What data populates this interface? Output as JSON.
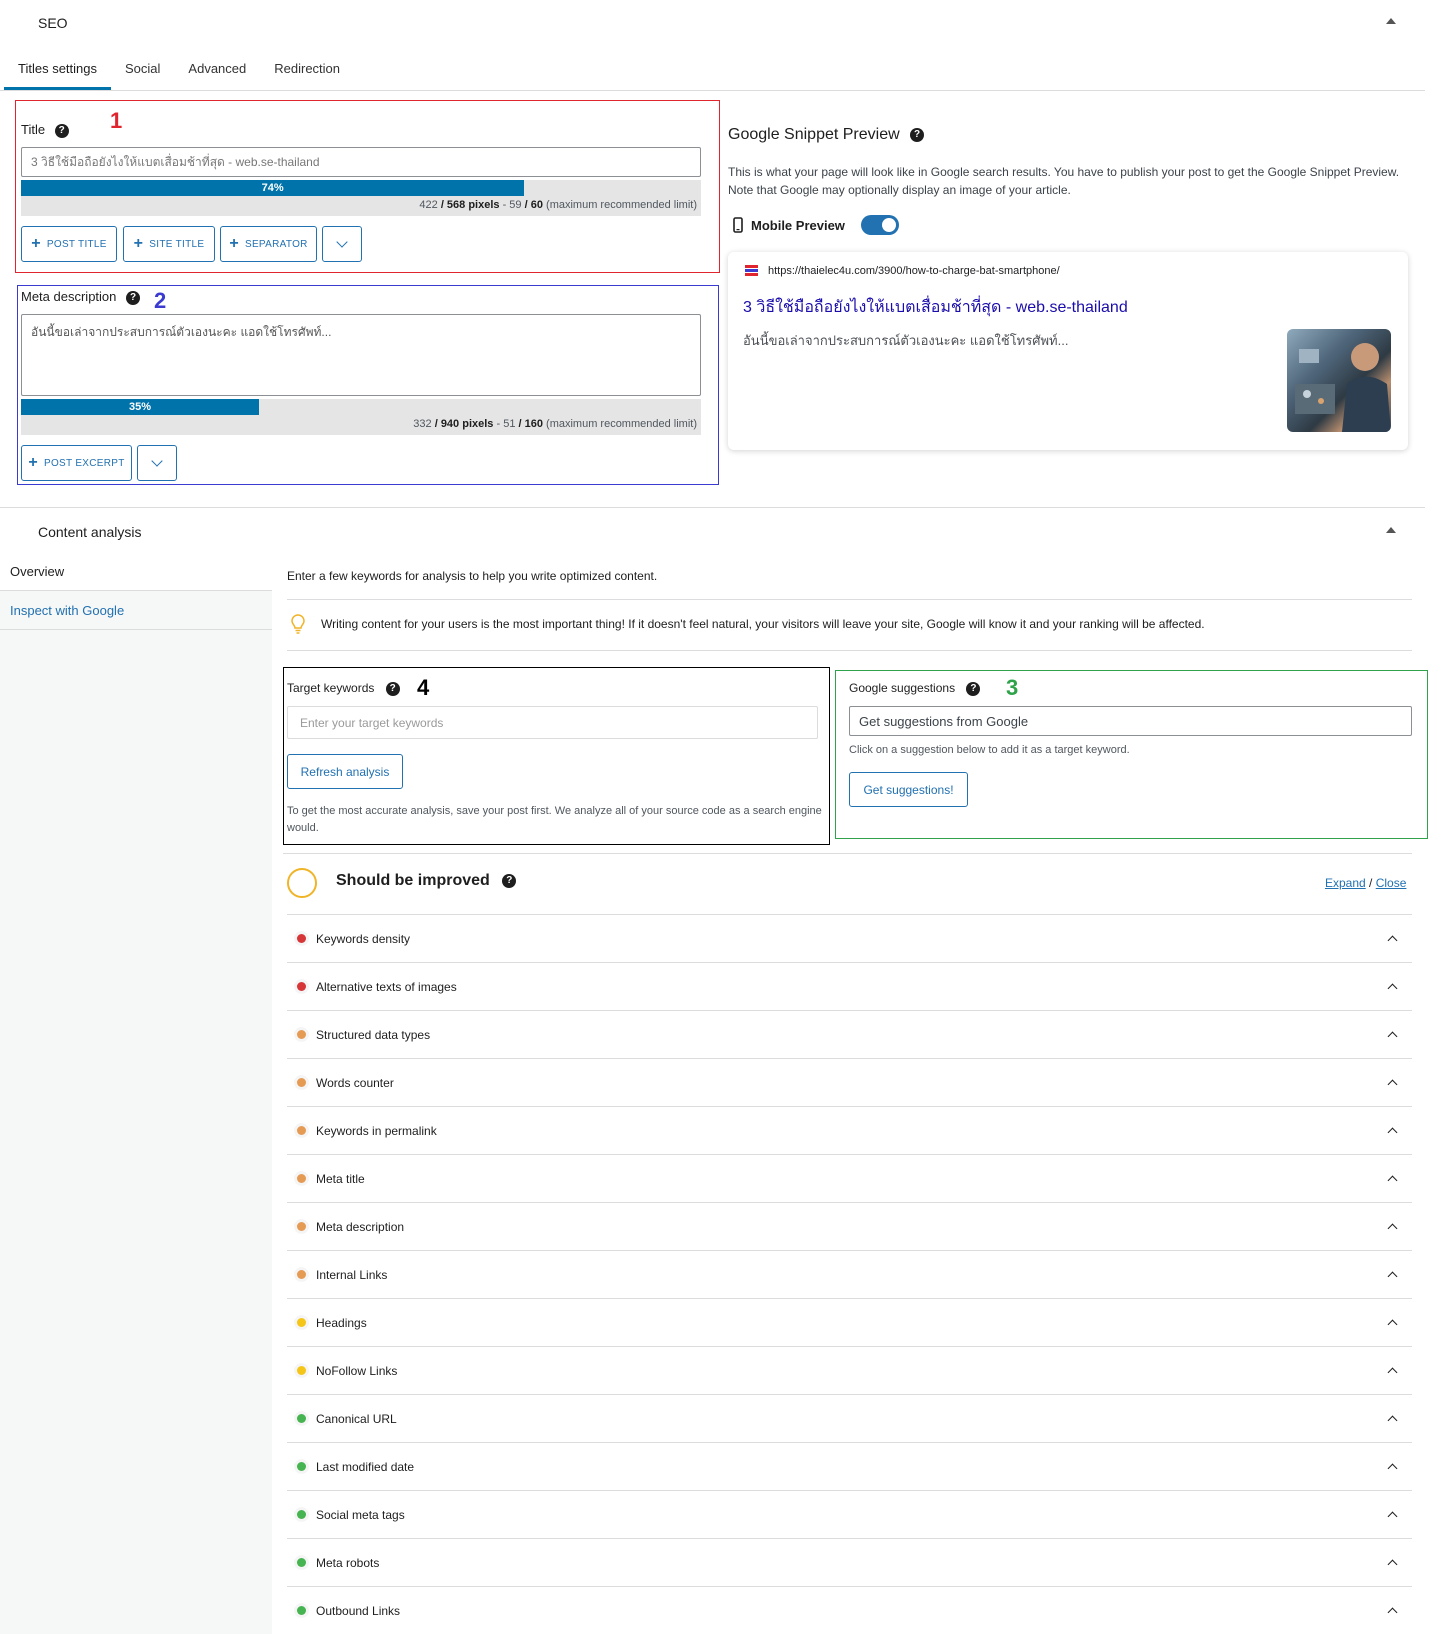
{
  "seo_panel": {
    "title": "SEO",
    "tabs": [
      "Titles settings",
      "Social",
      "Advanced",
      "Redirection"
    ]
  },
  "title_field": {
    "annotation": "1",
    "label": "Title",
    "value": "3 วิธีใช้มือถือยังไงให้แบตเสื่อมช้าที่สุด - web.se-thailand",
    "progress_label": "74%",
    "progress": 0.74,
    "pixels": "422",
    "pixels_max": "/ 568 pixels",
    "chars": " - 59 ",
    "chars_max": " / 60",
    "limit_text": " (maximum recommended limit)",
    "buttons": [
      "POST TITLE",
      "SITE TITLE",
      "SEPARATOR"
    ]
  },
  "meta_field": {
    "annotation": "2",
    "label": "Meta description",
    "value": "อันนี้ขอเล่าจากประสบการณ์ตัวเองนะคะ แอดใช้โทรศัพท์...",
    "progress_label": "35%",
    "progress": 0.35,
    "pixels": "332",
    "pixels_max": "/ 940 pixels",
    "chars": " - 51 ",
    "chars_max": " / 160",
    "limit_text": " (maximum recommended limit)",
    "buttons": [
      "POST EXCERPT"
    ]
  },
  "snippet": {
    "heading": "Google Snippet Preview",
    "description": "This is what your page will look like in Google search results. You have to publish your post to get the Google Snippet Preview. Note that Google may optionally display an image of your article.",
    "mobile_label": "Mobile Preview",
    "mobile_on": true,
    "url": "https://thaielec4u.com/3900/how-to-charge-bat-smartphone/",
    "title": "3 วิธีใช้มือถือยังไงให้แบตเสื่อมช้าที่สุด - web.se-thailand",
    "desc": "อันนี้ขอเล่าจากประสบการณ์ตัวเองนะคะ แอดใช้โทรศัพท์..."
  },
  "content_analysis": {
    "title": "Content analysis",
    "sidebar": [
      "Overview",
      "Inspect with Google"
    ],
    "intro": "Enter a few keywords for analysis to help you write optimized content.",
    "tip": "Writing content for your users is the most important thing! If it doesn't feel natural, your visitors will leave your site, Google will know it and your ranking will be affected.",
    "target": {
      "annotation": "4",
      "label": "Target keywords",
      "placeholder": "Enter your target keywords",
      "button": "Refresh analysis",
      "note": "To get the most accurate analysis, save your post first. We analyze all of your source code as a search engine would."
    },
    "suggest": {
      "annotation": "3",
      "label": "Google suggestions",
      "placeholder": "Get suggestions from Google",
      "note": "Click on a suggestion below to add it as a target keyword.",
      "button": "Get suggestions!"
    },
    "status": "Should be improved",
    "expand": "Expand",
    "sep": " / ",
    "close": "Close",
    "items": [
      {
        "label": "Keywords density",
        "color": "#d63638"
      },
      {
        "label": "Alternative texts of images",
        "color": "#d63638"
      },
      {
        "label": "Structured data types",
        "color": "#e69b55"
      },
      {
        "label": "Words counter",
        "color": "#e69b55"
      },
      {
        "label": "Keywords in permalink",
        "color": "#e69b55"
      },
      {
        "label": "Meta title",
        "color": "#e69b55"
      },
      {
        "label": "Meta description",
        "color": "#e69b55"
      },
      {
        "label": "Internal Links",
        "color": "#e69b55"
      },
      {
        "label": "Headings",
        "color": "#f5c518"
      },
      {
        "label": "NoFollow Links",
        "color": "#f5c518"
      },
      {
        "label": "Canonical URL",
        "color": "#46b450"
      },
      {
        "label": "Last modified date",
        "color": "#46b450"
      },
      {
        "label": "Social meta tags",
        "color": "#46b450"
      },
      {
        "label": "Meta robots",
        "color": "#46b450"
      },
      {
        "label": "Outbound Links",
        "color": "#46b450"
      }
    ]
  },
  "colors": {
    "accent": "#2271b1",
    "progress": "#0073aa",
    "annotation_red": "#e1252f",
    "annotation_blue": "#3b3bd1",
    "annotation_green": "#2fa34a",
    "status_ring": "#f0b429"
  }
}
